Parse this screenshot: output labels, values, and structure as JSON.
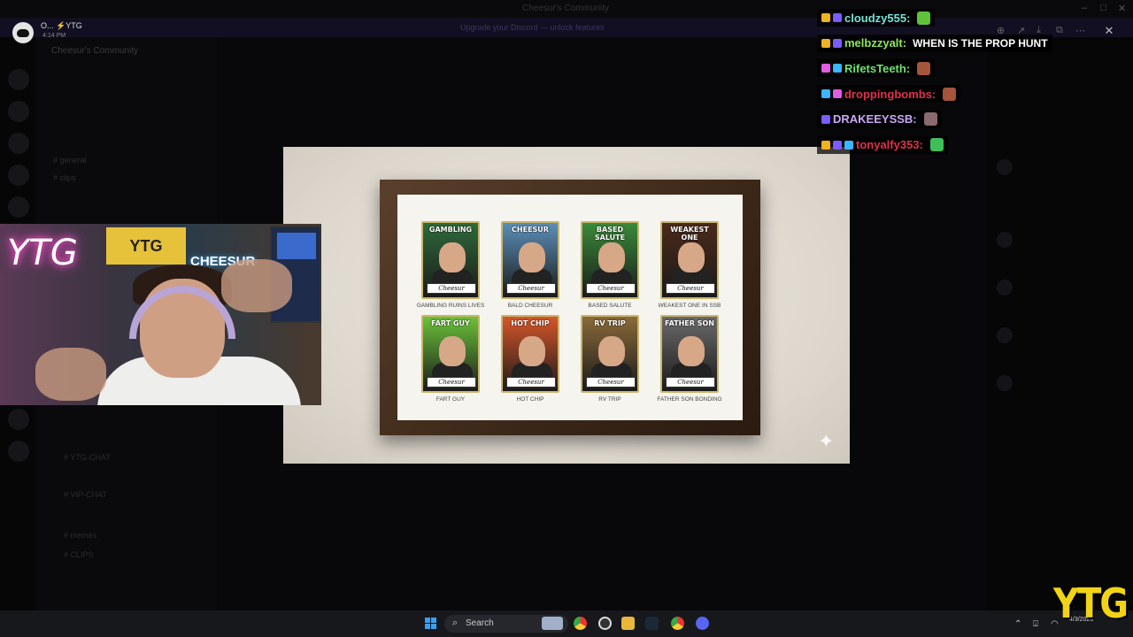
{
  "window": {
    "title": "Cheesur's Community"
  },
  "discord_notification": {
    "name": "O... ⚡YTG",
    "time": "4:14 PM"
  },
  "background_app": {
    "server_name": "Cheesur's Community",
    "banner_text": "Upgrade your Discord — unlock features",
    "channels": [
      "# general",
      "# clips",
      "# YTG-CHAT",
      "# VIP-CHAT",
      "# memes",
      "# CLIPS"
    ]
  },
  "popup": {
    "cards": [
      {
        "title": "GAMBLING",
        "label": "GAMBLING RUINS LIVES",
        "sig": "Cheesur",
        "bg": "#2f6a3a"
      },
      {
        "title": "CHEESUR",
        "label": "BALD CHEESUR",
        "sig": "Cheesur",
        "bg": "#5c8fb8"
      },
      {
        "title": "BASED SALUTE",
        "label": "BASED SALUTE",
        "sig": "Cheesur",
        "bg": "#3a8a3a"
      },
      {
        "title": "WEAKEST ONE",
        "label": "WEAKEST ONE IN SSB",
        "sig": "Cheesur",
        "bg": "#4a2a1a"
      },
      {
        "title": "FART GUY",
        "label": "FART GUY",
        "sig": "Cheesur",
        "bg": "#6cc23a"
      },
      {
        "title": "HOT CHIP",
        "label": "HOT CHIP",
        "sig": "Cheesur",
        "bg": "#d6562a"
      },
      {
        "title": "RV TRIP",
        "label": "RV TRIP",
        "sig": "Cheesur",
        "bg": "#8a6a3a"
      },
      {
        "title": "FATHER SON",
        "label": "FATHER SON BONDING",
        "sig": "Cheesur",
        "bg": "#6a6a6a"
      }
    ]
  },
  "webcam": {
    "neon_text": "YTG",
    "banner_text": "YTG",
    "banner2_text": "CHEESUR"
  },
  "chat": [
    {
      "user": "cloudzy555:",
      "color": "#7de0d2",
      "msg": "",
      "emote": "#5fc33a"
    },
    {
      "user": "melbzzyalt:",
      "color": "#8ee65a",
      "msg": "WHEN IS THE PROP HUNT",
      "emote": ""
    },
    {
      "user": "RifetsTeeth:",
      "color": "#6fe06f",
      "msg": "",
      "emote": "#a4553a"
    },
    {
      "user": "droppingbombs:",
      "color": "#e0314a",
      "msg": "",
      "emote": "#a4553a"
    },
    {
      "user": "DRAKEEYSSB:",
      "color": "#c9a8f5",
      "msg": "",
      "emote": "#8a6a70"
    },
    {
      "user": "tonyalfy353:",
      "color": "#e0314a",
      "msg": "",
      "emote": "#3fbf5a"
    }
  ],
  "taskbar": {
    "search_label": "Search",
    "date": "4/3/2026"
  },
  "watermark": "YTG",
  "colors": {
    "accent": "#f2d416",
    "discord": "#5865f2"
  }
}
